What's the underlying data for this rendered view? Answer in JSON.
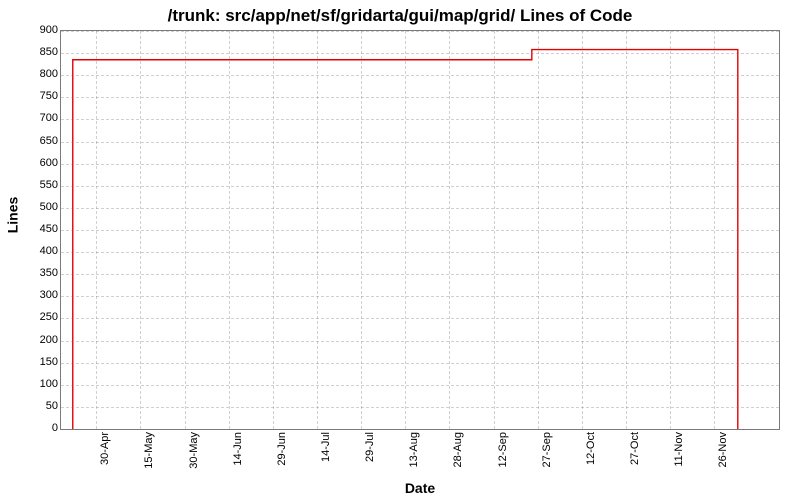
{
  "chart_data": {
    "type": "line",
    "title": "/trunk: src/app/net/sf/gridarta/gui/map/grid/ Lines of Code",
    "xlabel": "Date",
    "ylabel": "Lines",
    "ylim": [
      0,
      900
    ],
    "y_ticks": [
      0,
      50,
      100,
      150,
      200,
      250,
      300,
      350,
      400,
      450,
      500,
      550,
      600,
      650,
      700,
      750,
      800,
      850,
      900
    ],
    "x_ticks": [
      "30-Apr",
      "15-May",
      "30-May",
      "14-Jun",
      "29-Jun",
      "14-Jul",
      "29-Jul",
      "13-Aug",
      "28-Aug",
      "12-Sep",
      "27-Sep",
      "12-Oct",
      "27-Oct",
      "11-Nov",
      "26-Nov"
    ],
    "x_domain_days": [
      0,
      244
    ],
    "x_tick_days": [
      12,
      27,
      42,
      57,
      72,
      87,
      102,
      117,
      132,
      147,
      162,
      177,
      192,
      207,
      222
    ],
    "series": [
      {
        "name": "Lines of Code",
        "color": "#e60000",
        "points": [
          {
            "day": 4,
            "value": 0
          },
          {
            "day": 4,
            "value": 835
          },
          {
            "day": 160,
            "value": 835
          },
          {
            "day": 160,
            "value": 858
          },
          {
            "day": 230,
            "value": 858
          },
          {
            "day": 230,
            "value": 0
          }
        ]
      }
    ]
  }
}
